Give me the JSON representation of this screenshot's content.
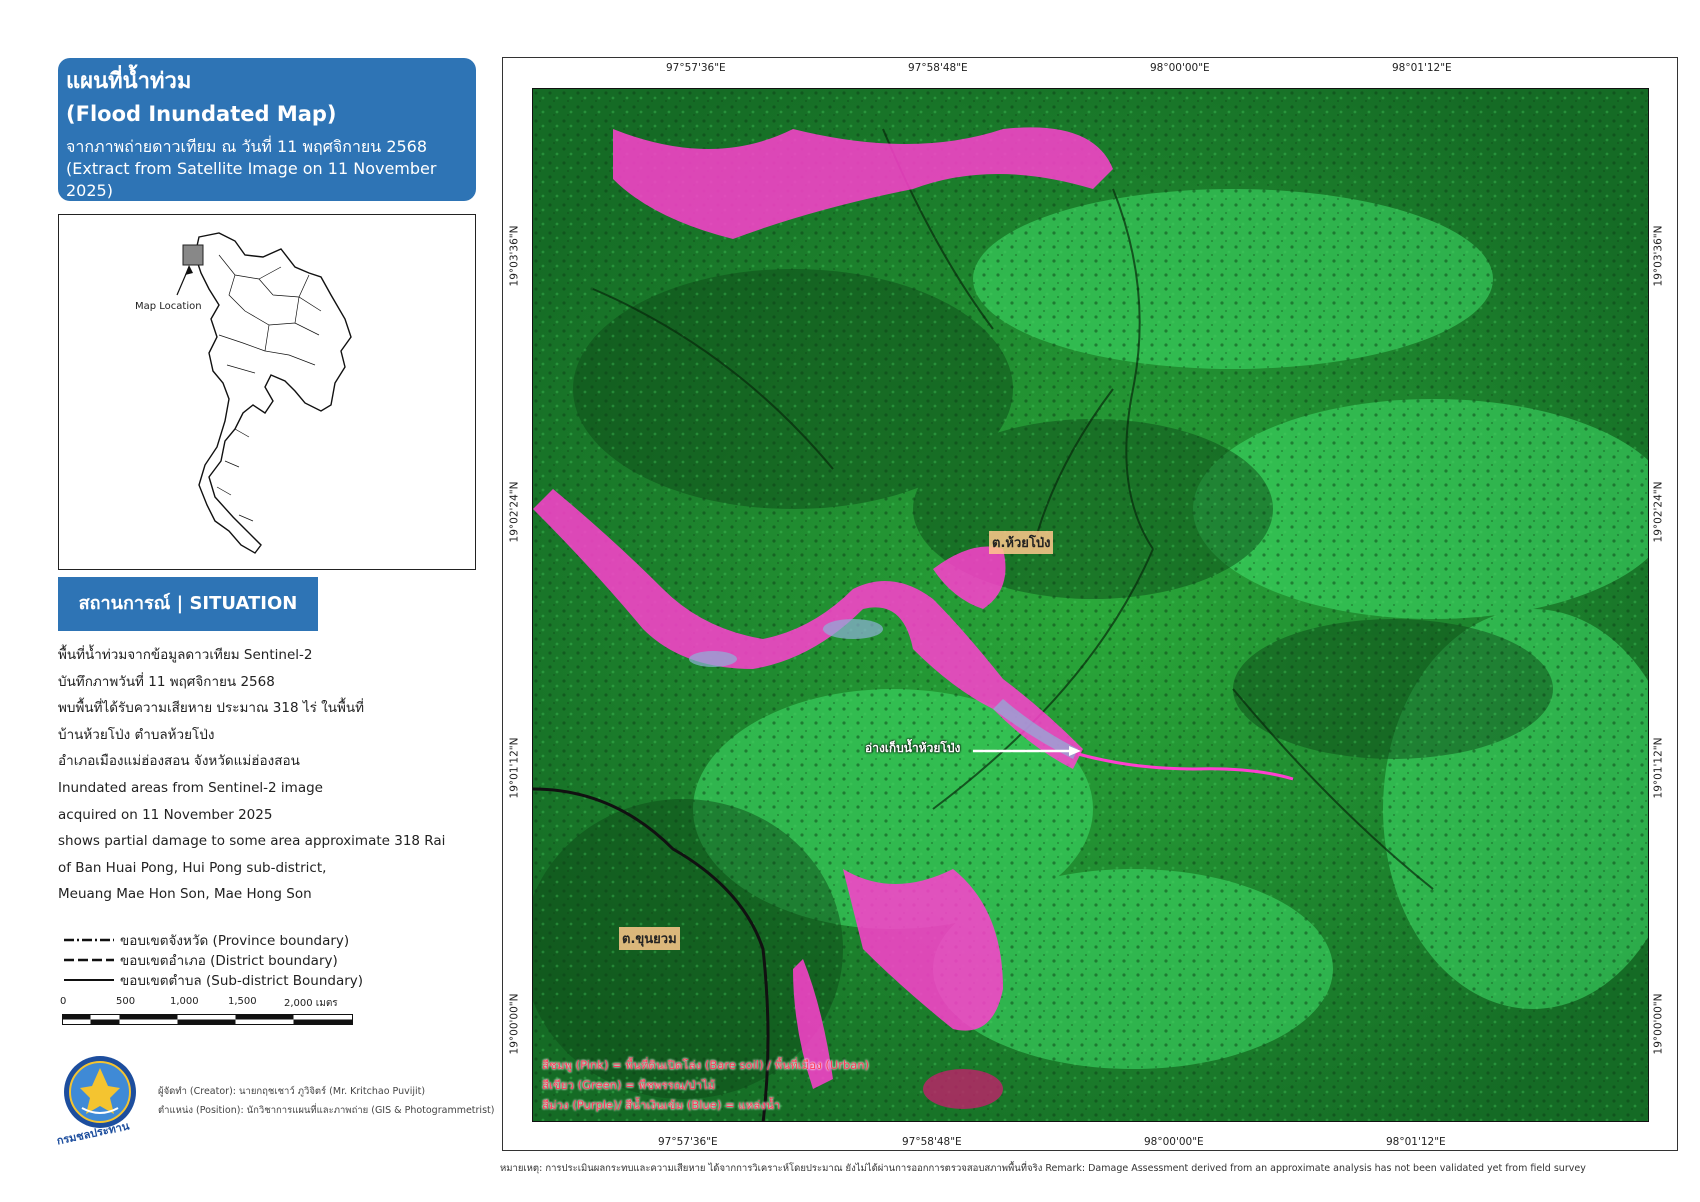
{
  "title": {
    "thai": "แผนที่น้ำท่วม",
    "english": "(Flood Inundated Map)",
    "subtitle_thai": "จากภาพถ่ายดาวเทียม ณ วันที่ 11 พฤศจิกายน 2568",
    "subtitle_english": "(Extract from Satellite Image on 11 November 2025)"
  },
  "locator": {
    "label": "Map Location"
  },
  "situation": {
    "heading": "สถานการณ์ | SITUATION",
    "lines": [
      "พื้นที่น้ำท่วมจากข้อมูลดาวเทียม Sentinel-2",
      "บันทึกภาพวันที่ 11 พฤศจิกายน 2568",
      "พบพื้นที่ได้รับความเสียหาย ประมาณ 318 ไร่ ในพื้นที่",
      "บ้านห้วยโป่ง ตำบลห้วยโป่ง",
      "อำเภอเมืองแม่ฮ่องสอน จังหวัดแม่ฮ่องสอน",
      "Inundated areas from Sentinel-2 image",
      "acquired on 11 November 2025",
      "shows partial damage to some area approximate 318 Rai",
      "of Ban Huai Pong, Hui Pong sub-district,",
      "Meuang Mae Hon Son, Mae Hong Son"
    ]
  },
  "legend": {
    "province": "ขอบเขตจังหวัด (Province boundary)",
    "district": "ขอบเขตอำเภอ (District boundary)",
    "subdistrict": "ขอบเขตตำบล (Sub-district Boundary)"
  },
  "scale": {
    "labels": [
      "0",
      "500",
      "1,000",
      "1,500",
      "2,000 เมตร"
    ]
  },
  "creator": {
    "name": "ผู้จัดทำ (Creator): นายกฤชเชาว์ ภูวิจิตร์ (Mr. Kritchao Puvijit)",
    "position": "ตำแหน่ง (Position): นักวิชาการแผนที่และภาพถ่าย (GIS & Photogrammetrist)"
  },
  "logo": {
    "text": "กรมชลประทาน",
    "icon": "royal-irrigation-department-seal"
  },
  "map": {
    "coords_top": [
      "97°57'36\"E",
      "97°58'48\"E",
      "98°00'00\"E",
      "98°01'12\"E"
    ],
    "coords_bottom": [
      "97°57'36\"E",
      "97°58'48\"E",
      "98°00'00\"E",
      "98°01'12\"E"
    ],
    "coords_left": [
      "19°03'36\"N",
      "19°02'24\"N",
      "19°01'12\"N",
      "19°00'00\"N"
    ],
    "coords_right": [
      "19°03'36\"N",
      "19°02'24\"N",
      "19°01'12\"N",
      "19°00'00\"N"
    ],
    "places": {
      "huai_pong": "ต.ห้วยโป่ง",
      "khun_yuam": "ต.ขุนยวม",
      "reservoir": "อ่างเก็บน้ำห้วยโป่ง"
    },
    "color_legend": [
      "สีชมพู (Pink) = พื้นที่ดินเปิดโล่ง (Bare soil) / พื้นที่เมือง (Urban)",
      "สีเขียว (Green) = พืชพรรณ/ป่าไม้",
      "สีม่วง (Purple)/ สีน้ำเงินเข้ม (Blue) = แหล่งน้ำ"
    ]
  },
  "remark": "หมายเหตุ: การประเมินผลกระทบและความเสียหาย ได้จากการวิเคราะห์โดยประมาณ ยังไม่ได้ผ่านการออกการตรวจสอบสภาพพื้นที่จริง Remark: Damage Assessment derived from an approximate analysis has not been validated yet from field survey",
  "colors": {
    "header_blue": "#2e74b5",
    "vegetation": "#1f7a2a",
    "bare_soil": "#ff3fd0"
  }
}
